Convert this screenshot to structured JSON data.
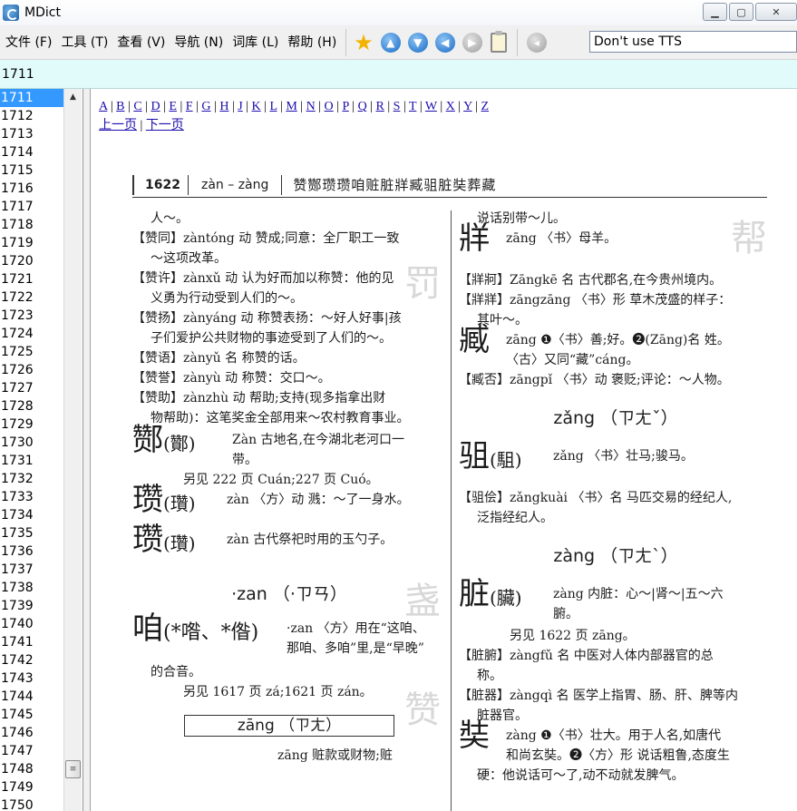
{
  "window": {
    "title": "MDict",
    "controls": [
      "▁",
      "▢",
      "✕"
    ]
  },
  "menu": [
    "文件 (F)",
    "工具 (T)",
    "查看 (V)",
    "导航 (N)",
    "词库 (L)",
    "帮助 (H)"
  ],
  "toolbar": {
    "tts_value": "Don't use TTS",
    "icons": [
      "star-icon",
      "up-arrow-icon",
      "down-arrow-icon",
      "back-arrow-icon",
      "forward-arrow-icon",
      "clipboard-icon",
      "speaker-icon"
    ]
  },
  "search": {
    "value": "1711"
  },
  "wordlist": {
    "selected": "1711",
    "items": [
      "1711",
      "1712",
      "1713",
      "1714",
      "1715",
      "1716",
      "1717",
      "1718",
      "1719",
      "1720",
      "1721",
      "1722",
      "1723",
      "1724",
      "1725",
      "1726",
      "1727",
      "1728",
      "1729",
      "1730",
      "1731",
      "1732",
      "1733",
      "1734",
      "1735",
      "1736",
      "1737",
      "1738",
      "1739",
      "1740",
      "1741",
      "1742",
      "1743",
      "1744",
      "1745",
      "1746",
      "1747",
      "1748",
      "1749",
      "1750"
    ]
  },
  "content": {
    "alphabet": [
      "A",
      "B",
      "C",
      "D",
      "E",
      "F",
      "G",
      "H",
      "J",
      "K",
      "L",
      "M",
      "N",
      "O",
      "P",
      "Q",
      "R",
      "S",
      "T",
      "W",
      "X",
      "Y",
      "Z"
    ],
    "prev_page": "上一页",
    "next_page": "下一页",
    "page_header": {
      "number": "1622",
      "range": "zàn – zàng",
      "chars": "赞酂瓒瓒咱赃脏牂臧驵脏奘葬藏"
    },
    "left_lines": [
      "人～。",
      "【赞同】zàntóng 动 赞成;同意：全厂职工一致",
      "～这项改革。",
      "【赞许】zànxǔ 动 认为好而加以称赞：他的见",
      "义勇为行动受到人们的～。",
      "【赞扬】zànyáng 动 称赞表扬：～好人好事|孩",
      "子们爱护公共财物的事迹受到了人们的～。",
      "【赞语】zànyǔ 名 称赞的话。",
      "【赞誉】zànyù 动 称赞：交口～。",
      "【赞助】zànzhù 动 帮助;支持(现多指拿出财",
      "物帮助)：这笔奖金全部用来～农村教育事业。"
    ],
    "zan_head": {
      "char": "酂",
      "trad": "(酇)",
      "text": "Zàn 古地名,在今湖北老河口一",
      "cont": "带。"
    },
    "zan_see": "另见 222 页 Cuán;227 页 Cuó。",
    "zan2": {
      "char": "瓒",
      "trad": "(瓚)",
      "text": "zàn 〈方〉动 溅：～了一身水。"
    },
    "zan3": {
      "char": "瓒",
      "trad": "(瓚)",
      "text": "zàn 古代祭祀时用的玉勺子。"
    },
    "zan_light": "·zan （·ㄗㄢ）",
    "zan4": {
      "char": "咱",
      "trad": "(*喒、*偺)",
      "text": "·zan 〈方〉用在“这咱、",
      "cont": "那咱、多咱”里,是“早晚”"
    },
    "zan4_cont": "的合音。",
    "zan4_see": "另见 1617 页 zá;1621 页 zán。",
    "zang_box": "zāng （ㄗㄤ）",
    "zang_bottom": "zāng 赃款或财物;赃",
    "right_lines_top": [
      "说话别带～儿。"
    ],
    "zang1": {
      "char": "牂",
      "text": "zāng 〈书〉母羊。"
    },
    "right_lines_mid": [
      "【牂牁】Zāngkē 名 古代郡名,在今贵州境内。",
      "【牂牂】zāngzāng 〈书〉形 草木茂盛的样子：",
      "其叶～。"
    ],
    "zang2": {
      "char": "臧",
      "text": "zāng ❶〈书〉善;好。❷(Zāng)名 姓。",
      "cont": "〈古〉又同“藏”cáng。"
    },
    "zang2_line": "【臧否】zāngpǐ 〈书〉动 褒贬;评论：～人物。",
    "zang3_head": "zǎng （ㄗㄤˇ）",
    "zang3": {
      "char": "驵",
      "trad": "(駔)",
      "text": "zǎng 〈书〉壮马;骏马。"
    },
    "zang3_lines": [
      "【驵侩】zǎngkuài 〈书〉名 马匹交易的经纪人,",
      "泛指经纪人。"
    ],
    "zang4_head": "zàng （ㄗㄤˋ）",
    "zang4": {
      "char": "脏",
      "trad": "(臟)",
      "text": "zàng 内脏：心～|肾～|五～六",
      "cont": "腑。"
    },
    "zang4_see": "另见 1622 页 zāng。",
    "zang4_lines": [
      "【脏腑】zàngfǔ 名 中医对人体内部器官的总",
      "称。",
      "【脏器】zàngqì 名 医学上指胃、肠、肝、脾等内",
      "脏器官。"
    ],
    "zang5": {
      "char": "奘",
      "text": "zàng ❶〈书〉壮大。用于人名,如唐代",
      "cont": "和尚玄奘。❷〈方〉形 说话粗鲁,态度生"
    },
    "zang5_line": "硬：他说话可～了,动不动就发脾气。"
  }
}
